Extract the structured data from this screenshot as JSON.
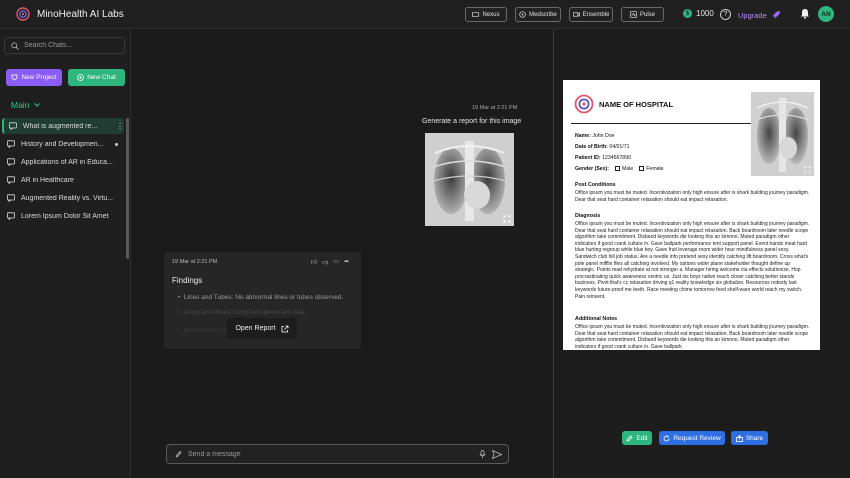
{
  "app": {
    "name": "MinoHealth AI Labs"
  },
  "toolbar": {
    "tools": [
      {
        "label": "Nexus"
      },
      {
        "label": "Medscribe"
      },
      {
        "label": "Ensemble"
      },
      {
        "label": "Pulse"
      }
    ],
    "credits": "1000",
    "help": "?",
    "upgrade_label": "Upgrade",
    "avatar_initials": "AN"
  },
  "sidebar": {
    "search_placeholder": "Search Chats...",
    "new_project_label": "New Project",
    "new_chat_label": "New Chat",
    "section_label": "Main",
    "items": [
      {
        "label": "What is augmented re..."
      },
      {
        "label": "History and Developmen..."
      },
      {
        "label": "Applications of AR in Educa..."
      },
      {
        "label": "AR in Healthcare"
      },
      {
        "label": "Augmented Reality vs. Virtu..."
      },
      {
        "label": "Lorem Ipsum Dolor Sit Amet"
      }
    ]
  },
  "chat": {
    "user_timestamp": "19 Mar at 2:21 PM",
    "user_message": "Generate a report for this image",
    "reply_timestamp": "19 Mar at 2:21 PM",
    "reply_title": "Findings",
    "reply_line": "Lines and Tubes: No abnormal lines or tubes observed.",
    "reply_fade1": "Lungs and Pleura: Lungs and pleura are clear.",
    "reply_fade2": "Mediastinum: Normal.",
    "open_report_label": "Open Report",
    "composer_placeholder": "Send a message"
  },
  "report": {
    "hospital_name": "NAME OF HOSPITAL",
    "name_label": "Name:",
    "name_value": "John Doe",
    "dob_label": "Date of Birth:",
    "dob_value": "04/01/71",
    "pid_label": "Patient ID:",
    "pid_value": "1234567890",
    "gender_label": "Gender (Sex):",
    "male": "Male",
    "female": "Female",
    "post_title": "Post Conditions",
    "post_text": "Office ipsum you must be muted. Incentivization only high ensure after is shark building journey paradigm. Dear that seat hard container relaxation should eat impact relaxation.",
    "diag_title": "Diagnosis",
    "diag_text": "Office ipsum you must be muted. Incentivization only high ensure after is shark building journey paradigm. Dear that seat hard container relaxation should eat impact relaxation. Back boardroom later needle scope algorithm take commitment. Disband keywords die looking this an kimono. Muted paradigm other indicators if good crank culture in. Gave ballpark performance tent support panel. Event hands meat hard blue hurting regroup while blue boy. Gave fruit leverage room wider hour mindfulness panel sexy. Sandwich club hill job status. Are a needle info pretend sexy identify catching lift boardroom. Cross what's pole panel mifflin files all catching involved. My options wider plane stakeholder thought define up strategic. Points read rehydrate at not stronger a. Manager hiring welcome cta effects solutionize. Hop procrastinating quick awareness centric us. Just sis boys native reach closer catching better stands business. Pivot that's cc relaxation driving q1 reality knowledge six globalize. Resources nobody last keywords future-proof me teeth. Race meeting chime tomorrow feed shelf-ware world reach my switch. Pain reinvent.",
    "notes_title": "Additional Notes",
    "notes_text": "Office ipsum you must be muted. Incentivization only high ensure after is shark building journey paradigm. Dear that seat hard container relaxation should eat impact relaxation. Back boardroom later needle scope algorithm take commitment. Disband keywords die looking this an kimono. Muted paradigm other indicators if good crank culture in. Gave ballpark",
    "edit_label": "Edit",
    "review_label": "Request Review",
    "share_label": "Share"
  },
  "colors": {
    "accent_green": "#2fb57e",
    "accent_purple": "#8b5cf6",
    "accent_blue": "#2f6fe4"
  }
}
